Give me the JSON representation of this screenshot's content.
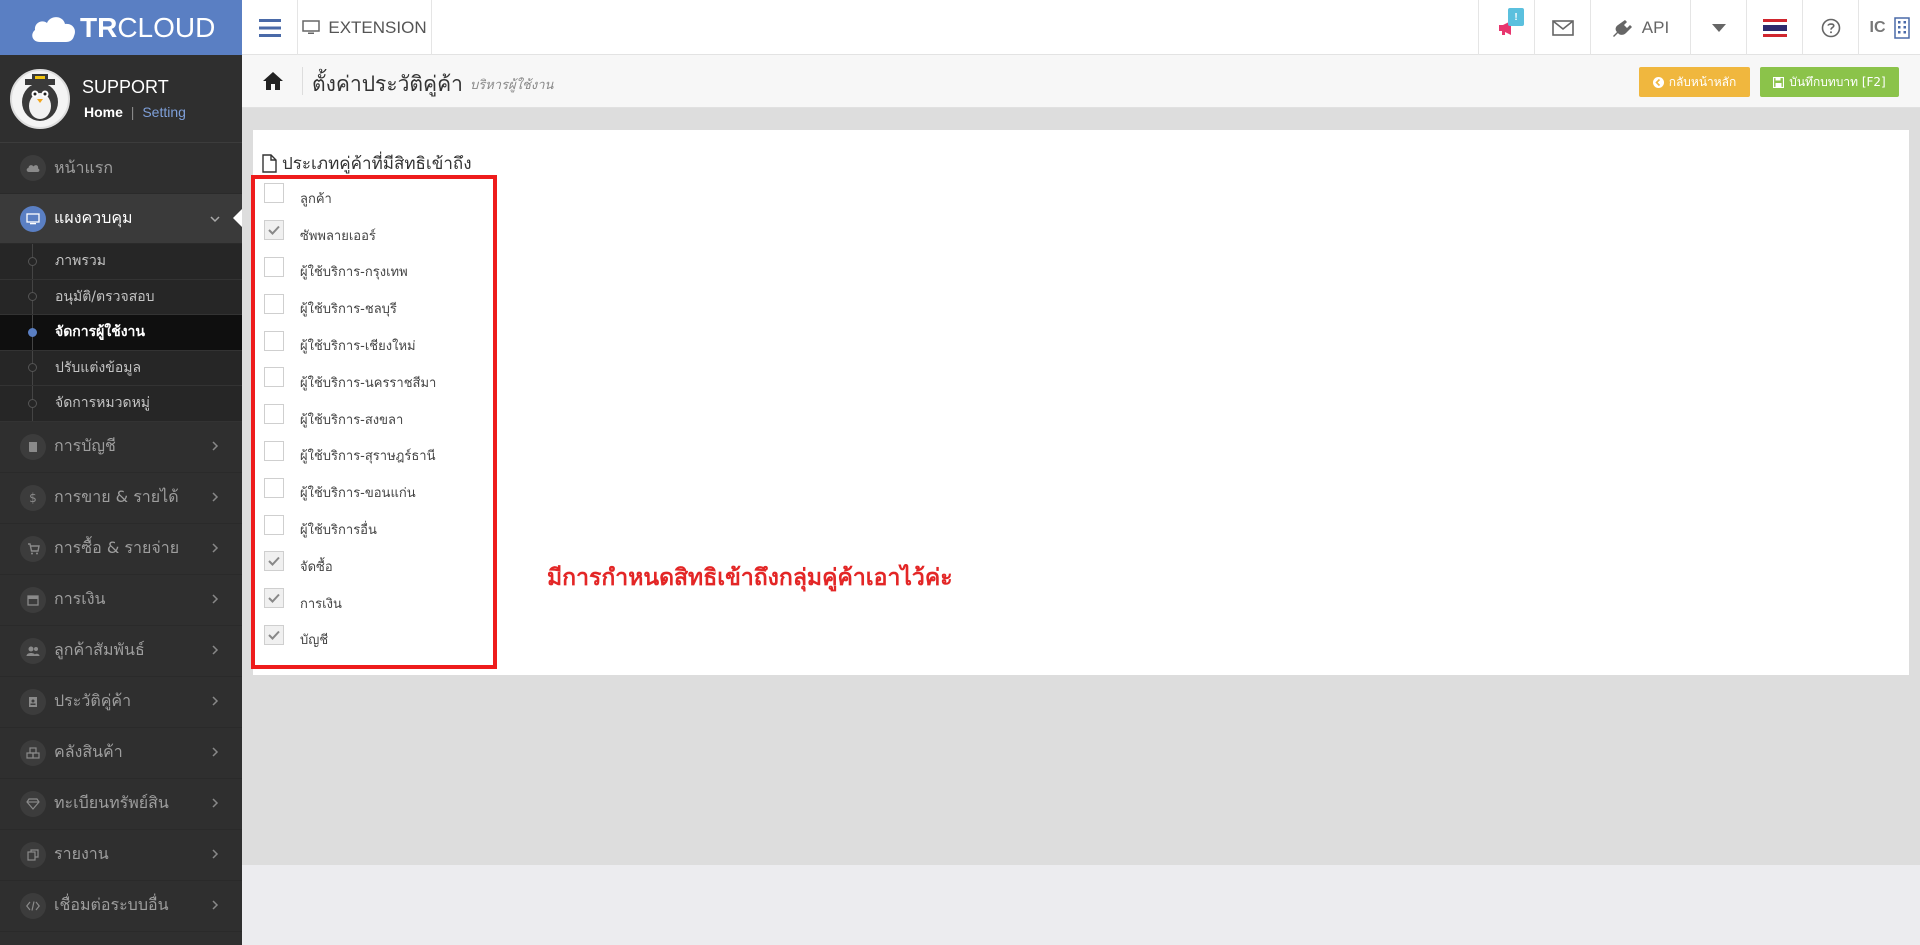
{
  "brand": {
    "logo_text_bold": "TR",
    "logo_text_light": "CLOUD"
  },
  "topbar": {
    "extension_label": "EXTENSION",
    "notification_count": "!",
    "api_label": "API",
    "ic_label": "IC"
  },
  "profile": {
    "name": "SUPPORT",
    "home_link": "Home",
    "separator": "|",
    "setting_link": "Setting"
  },
  "sidebar": {
    "items": [
      {
        "label": "หน้าแรก"
      },
      {
        "label": "แผงควบคุม"
      },
      {
        "label": "การบัญชี"
      },
      {
        "label": "การขาย & รายได้"
      },
      {
        "label": "การซื้อ & รายจ่าย"
      },
      {
        "label": "การเงิน"
      },
      {
        "label": "ลูกค้าสัมพันธ์"
      },
      {
        "label": "ประวัติคู่ค้า"
      },
      {
        "label": "คลังสินค้า"
      },
      {
        "label": "ทะเบียนทรัพย์สิน"
      },
      {
        "label": "รายงาน"
      },
      {
        "label": "เชื่อมต่อระบบอื่น"
      }
    ],
    "submenu": [
      {
        "label": "ภาพรวม"
      },
      {
        "label": "อนุมัติ/ตรวจสอบ"
      },
      {
        "label": "จัดการผู้ใช้งาน"
      },
      {
        "label": "ปรับแต่งข้อมูล"
      },
      {
        "label": "จัดการหมวดหมู่"
      }
    ]
  },
  "header": {
    "title": "ตั้งค่าประวัติคู่ค้า",
    "subtitle": "บริหารผู้ใช้งาน",
    "back_button": "กลับหน้าหลัก",
    "save_button": "บันทึกบทบาท [F2]"
  },
  "panel": {
    "title": "ประเภทคู่ค้าที่มีสิทธิเข้าถึง",
    "options": [
      {
        "label": "ลูกค้า",
        "checked": false
      },
      {
        "label": "ซัพพลายเออร์",
        "checked": true
      },
      {
        "label": "ผู้ใช้บริการ-กรุงเทพ",
        "checked": false
      },
      {
        "label": "ผู้ใช้บริการ-ชลบุรี",
        "checked": false
      },
      {
        "label": "ผู้ใช้บริการ-เชียงใหม่",
        "checked": false
      },
      {
        "label": "ผู้ใช้บริการ-นครราชสีมา",
        "checked": false
      },
      {
        "label": "ผู้ใช้บริการ-สงขลา",
        "checked": false
      },
      {
        "label": "ผู้ใช้บริการ-สุราษฎร์ธานี",
        "checked": false
      },
      {
        "label": "ผู้ใช้บริการ-ขอนแก่น",
        "checked": false
      },
      {
        "label": "ผู้ใช้บริการอื่น",
        "checked": false
      },
      {
        "label": "จัดซื้อ",
        "checked": true
      },
      {
        "label": "การเงิน",
        "checked": true
      },
      {
        "label": "บัญชี",
        "checked": true
      }
    ]
  },
  "annotation": {
    "text": "มีการกำหนดสิทธิเข้าถึงกลุ่มคู่ค้าเอาไว้ค่ะ"
  },
  "colors": {
    "brand": "#5a7fc3",
    "back_button": "#f0b73e",
    "save_button": "#8bc34a",
    "highlight": "#ee1c1c"
  }
}
